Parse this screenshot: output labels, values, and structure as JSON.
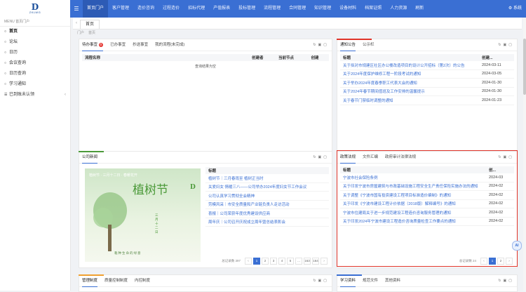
{
  "logo": {
    "mark": "D",
    "text": "ZKLWG"
  },
  "topnav": {
    "items": [
      "首页门户",
      "客户管理",
      "造价咨询",
      "过程造价",
      "招标代理",
      "产值报表",
      "投标管理",
      "流程管理",
      "合同管理",
      "知识管理",
      "设备材料",
      "档案证照",
      "人力资源",
      "刷新"
    ],
    "system": "系统"
  },
  "sidebar": {
    "header": "MENU 首页门户",
    "items": [
      {
        "label": "首页",
        "icon": "○",
        "active": true
      },
      {
        "label": "论坛",
        "icon": "○"
      },
      {
        "label": "日历",
        "icon": "○"
      },
      {
        "label": "会议查询",
        "icon": "○"
      },
      {
        "label": "日历查询",
        "icon": "○"
      },
      {
        "label": "学习通知",
        "icon": "○"
      },
      {
        "label": "已到账未认领",
        "icon": "☰",
        "chevron": "‹"
      }
    ]
  },
  "tabsbar": {
    "left": "‹",
    "tab": "首页",
    "right": "›"
  },
  "breadcrumb": [
    "门户",
    "首页"
  ],
  "todo": {
    "tabs": [
      "待办事宜",
      "已办事宜",
      "抄送事宜",
      "我的流程(未完成)"
    ],
    "badge": "0",
    "columns": [
      "流程名称",
      "创建者",
      "当前节点",
      "创建"
    ],
    "empty": "查询结果为空",
    "pager": {
      "info": "总记录数 0",
      "next": "›"
    }
  },
  "notice": {
    "tabs": [
      "通知公告",
      "公示栏"
    ],
    "columns": [
      "标题",
      "创建..."
    ],
    "rows": [
      {
        "title": "关于拟对市规建区社区办公楼改造项目的设计公开招标（第2次）的公告",
        "date": "2024-03-11"
      },
      {
        "title": "关于2024年度保护维修工程一阶段考试的通知",
        "date": "2024-03-05"
      },
      {
        "title": "关于举办2024年度春季职工代表大会的通知",
        "date": "2024-01-30"
      },
      {
        "title": "关于2024年春节期间值班及工作安排的温馨提示",
        "date": "2024-01-30"
      },
      {
        "title": "关于春节门禁临时调整的通知",
        "date": "2024-01-23"
      }
    ],
    "pager": {
      "info": "总记录数 204",
      "prev": "‹",
      "pages": [
        "1",
        "2",
        "3",
        "4",
        "5",
        "...",
        "41"
      ],
      "current": "1",
      "next": "›",
      "goto": "32",
      "size": "20"
    }
  },
  "news": {
    "tab": "公司新闻",
    "columns": [
      "标题"
    ],
    "image": {
      "caption": "植树节 · 三月十二日 · 春暖花开",
      "title": "植树节",
      "date": "三月十二日",
      "sub": "栽种生命的绿意",
      "logo": "D"
    },
    "rows": [
      {
        "title": "植树节｜三月春雨至 植树正当时"
      },
      {
        "title": "关爱妇女 情暖三八——公司举办2024年度妇女节工作会议"
      },
      {
        "title": "公司认真学习贯彻全会精神"
      },
      {
        "title": "劳模风采｜市安全质量和产业链负责人走访活动"
      },
      {
        "title": "喜报｜公司荣获年度优秀建设供应商"
      },
      {
        "title": "周年庆｜公司召开庆祝成立周年暨总结表彰会"
      }
    ],
    "pager": {
      "info": "总记录数 397",
      "prev": "‹",
      "pages": [
        "1",
        "2",
        "3",
        "4",
        "5",
        "...",
        "163",
        "164"
      ],
      "current": "1",
      "next": "›"
    }
  },
  "policy": {
    "tabs": [
      "政策法规",
      "文件汇编",
      "政府审计法律法规"
    ],
    "columns": [
      "标题",
      "创..."
    ],
    "rows": [
      {
        "title": "宁波市社会保险条例",
        "date": "2024-03"
      },
      {
        "title": "关于印发宁波市房屋建筑与市政基础设施工程安全生产责任保险实施办法的通知",
        "date": "2024-02"
      },
      {
        "title": "关于调整《宁波市国有投资建设工程项目标准造价编制》的通知",
        "date": "2024-02"
      },
      {
        "title": "关于印发《宁波市建设工程计价依据（2018版）解释编号》的通知",
        "date": "2024-02"
      },
      {
        "title": "宁波市住建局关于进一步规范建设工程造价咨询服务管理的通知",
        "date": "2024-02"
      },
      {
        "title": "关于印发2024年宁波市建设工程造价咨询质量检查工作要点的通知",
        "date": "2024-02"
      }
    ],
    "pager": {
      "info": "总记录数 24",
      "prev": "‹",
      "pages": [
        "1",
        "2"
      ],
      "current": "1",
      "next": "›"
    }
  },
  "bottom_left": {
    "tabs": [
      "管理制度",
      "质量控制制度",
      "内控制度"
    ]
  },
  "bottom_right": {
    "tabs": [
      "学习资料",
      "规范文件",
      "其他资料"
    ]
  },
  "ai_badge": "AI",
  "colors": {
    "primary": "#3a6fd3",
    "highlight": "#e0342a",
    "accent_green": "#4c9a3a",
    "accent_orange": "#f0a030"
  }
}
